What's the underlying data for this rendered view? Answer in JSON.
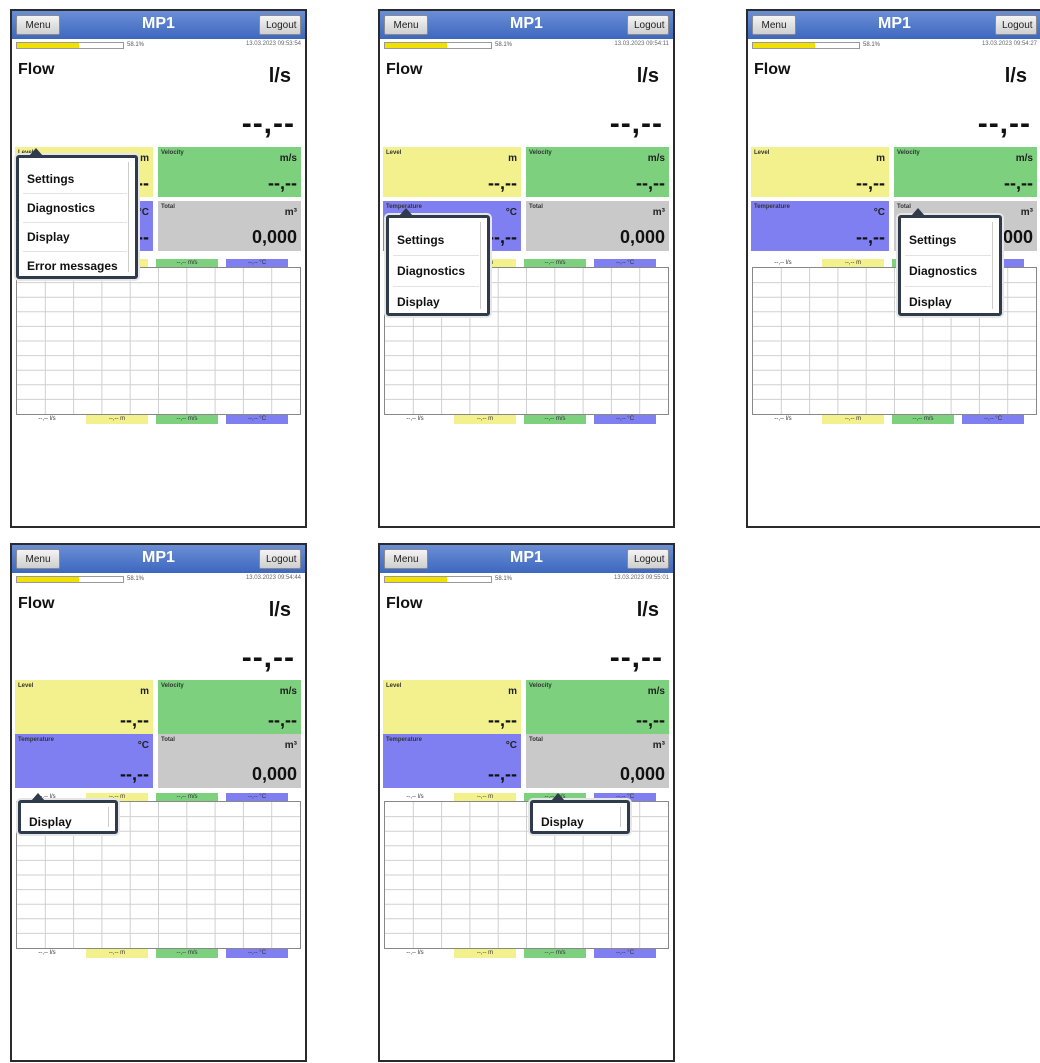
{
  "app": {
    "title": "MP1",
    "menu_label": "Menu",
    "logout_label": "Logout",
    "progress_percent": 58.1,
    "progress_label": "58.1%",
    "flow_label": "Flow",
    "flow_unit": "l/s",
    "flow_value": "--,--",
    "tile_labels": {
      "level": "Level",
      "velocity": "Velocity",
      "temperature": "Temperature",
      "total": "Total"
    },
    "tile_units": {
      "level": "m",
      "velocity": "m/s",
      "temperature": "°C",
      "total": "m³"
    },
    "tile_values": {
      "level": "--,--",
      "velocity": "--,--",
      "temperature": "--,--",
      "total": "0,000"
    },
    "legend": {
      "flow": "--,-- l/s",
      "level": "--,-- m",
      "velocity": "--,-- m/s",
      "temperature": "--,-- °C"
    }
  },
  "screens": [
    {
      "timestamp": "13.03.2023 09:53:54",
      "menu_items": [
        "Settings",
        "Diagnostics",
        "Display",
        "Error messages"
      ]
    },
    {
      "timestamp": "13.03.2023 09:54:11",
      "menu_items": [
        "Settings",
        "Diagnostics",
        "Display"
      ]
    },
    {
      "timestamp": "13.03.2023 09:54:27",
      "menu_items": [
        "Settings",
        "Diagnostics",
        "Display"
      ]
    },
    {
      "timestamp": "13.03.2023 09:54:44",
      "menu_items": [
        "Display"
      ]
    },
    {
      "timestamp": "13.03.2023 09:55:01",
      "menu_items": [
        "Display"
      ]
    }
  ]
}
